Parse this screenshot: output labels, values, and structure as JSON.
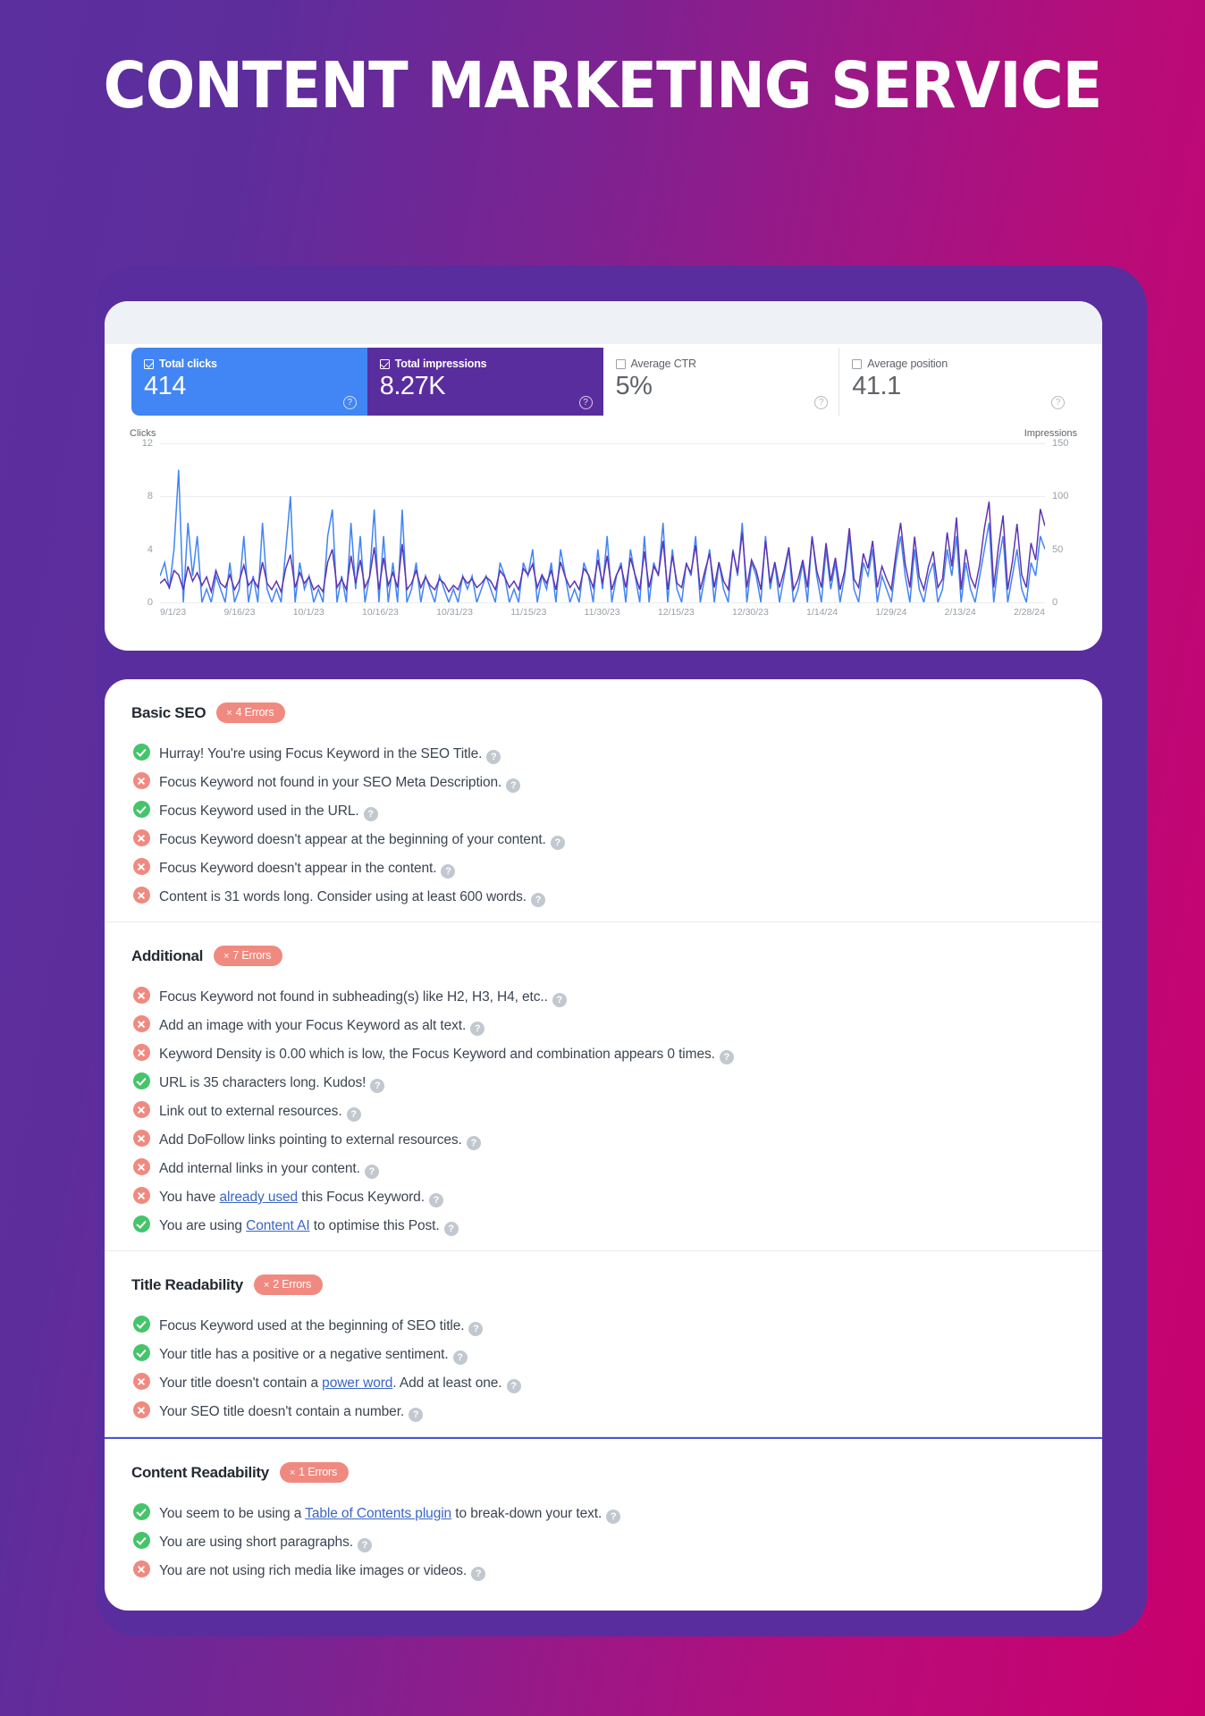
{
  "header": {
    "title": "CONTENT MARKETING SERVICE"
  },
  "metrics": [
    {
      "label": "Total clicks",
      "value": "414",
      "checked": true,
      "theme": "clicks"
    },
    {
      "label": "Total impressions",
      "value": "8.27K",
      "checked": true,
      "theme": "impressions"
    },
    {
      "label": "Average CTR",
      "value": "5%",
      "checked": false,
      "theme": "plain"
    },
    {
      "label": "Average position",
      "value": "41.1",
      "checked": false,
      "theme": "plain"
    }
  ],
  "chart_data": {
    "type": "line",
    "title": "",
    "left_axis_label": "Clicks",
    "right_axis_label": "Impressions",
    "left_ticks": [
      "12",
      "8",
      "4",
      "0"
    ],
    "right_ticks": [
      "150",
      "100",
      "50",
      "0"
    ],
    "ylim_left": [
      0,
      12
    ],
    "ylim_right": [
      0,
      150
    ],
    "grid": true,
    "legend_position": "none",
    "x_tick_labels": [
      "9/1/23",
      "9/16/23",
      "10/1/23",
      "10/16/23",
      "10/31/23",
      "11/15/23",
      "11/30/23",
      "12/15/23",
      "12/30/23",
      "1/14/24",
      "1/29/24",
      "2/13/24",
      "2/28/24"
    ],
    "series": [
      {
        "name": "Clicks",
        "color": "#4285f4",
        "axis": "left",
        "values": [
          2,
          3,
          1,
          4,
          10,
          0,
          6,
          2,
          5,
          0,
          1,
          0,
          2,
          1,
          0,
          3,
          0,
          1,
          5,
          0,
          2,
          0,
          6,
          1,
          0,
          1,
          0,
          4,
          8,
          0,
          3,
          1,
          2,
          0,
          1,
          0,
          5,
          7,
          0,
          2,
          0,
          6,
          1,
          5,
          0,
          2,
          7,
          0,
          5,
          0,
          3,
          0,
          7,
          0,
          1,
          3,
          0,
          2,
          1,
          0,
          2,
          1,
          0,
          1,
          0,
          2,
          1,
          2,
          0,
          1,
          2,
          1,
          0,
          3,
          2,
          0,
          1,
          0,
          3,
          2,
          4,
          0,
          2,
          1,
          3,
          0,
          4,
          2,
          0,
          1,
          0,
          3,
          2,
          0,
          4,
          1,
          5,
          0,
          2,
          3,
          0,
          4,
          2,
          0,
          5,
          0,
          3,
          2,
          6,
          0,
          4,
          1,
          0,
          3,
          2,
          5,
          0,
          2,
          4,
          0,
          3,
          1,
          0,
          4,
          2,
          6,
          0,
          3,
          2,
          0,
          5,
          1,
          3,
          0,
          2,
          4,
          0,
          1,
          3,
          0,
          5,
          2,
          0,
          4,
          1,
          3,
          0,
          2,
          5,
          1,
          0,
          3,
          2,
          4,
          0,
          2,
          1,
          0,
          3,
          5,
          2,
          0,
          4,
          1,
          0,
          2,
          3,
          0,
          1,
          4,
          2,
          5,
          0,
          3,
          1,
          0,
          2,
          4,
          6,
          0,
          3,
          5,
          0,
          2,
          4,
          1,
          0,
          3,
          2,
          5,
          4
        ]
      },
      {
        "name": "Impressions",
        "color": "#5e35b1",
        "axis": "right",
        "values": [
          18,
          22,
          14,
          30,
          26,
          12,
          34,
          20,
          28,
          16,
          24,
          10,
          30,
          18,
          14,
          26,
          12,
          20,
          35,
          16,
          22,
          14,
          38,
          18,
          12,
          20,
          10,
          32,
          45,
          14,
          28,
          18,
          24,
          12,
          16,
          10,
          38,
          50,
          14,
          22,
          12,
          44,
          18,
          40,
          14,
          24,
          52,
          12,
          42,
          16,
          28,
          14,
          55,
          12,
          18,
          30,
          14,
          24,
          16,
          12,
          22,
          18,
          10,
          16,
          12,
          24,
          18,
          22,
          14,
          18,
          24,
          20,
          12,
          30,
          24,
          14,
          20,
          12,
          32,
          26,
          36,
          14,
          26,
          18,
          30,
          12,
          38,
          24,
          14,
          20,
          12,
          32,
          26,
          14,
          40,
          18,
          44,
          12,
          26,
          34,
          14,
          42,
          26,
          12,
          48,
          14,
          34,
          26,
          58,
          12,
          44,
          18,
          14,
          36,
          28,
          54,
          12,
          30,
          46,
          14,
          38,
          20,
          12,
          48,
          28,
          66,
          14,
          40,
          30,
          12,
          58,
          18,
          38,
          14,
          30,
          52,
          12,
          22,
          40,
          14,
          62,
          30,
          14,
          56,
          20,
          42,
          12,
          30,
          70,
          22,
          14,
          46,
          32,
          58,
          14,
          34,
          22,
          12,
          46,
          75,
          36,
          14,
          62,
          24,
          12,
          34,
          48,
          14,
          22,
          66,
          34,
          80,
          12,
          50,
          24,
          14,
          36,
          70,
          95,
          14,
          52,
          82,
          12,
          38,
          74,
          26,
          14,
          56,
          40,
          88,
          72
        ]
      }
    ]
  },
  "seo_sections": [
    {
      "title": "Basic SEO",
      "badge": "4 Errors",
      "highlight": false,
      "items": [
        {
          "status": "ok",
          "text": "Hurray! You're using Focus Keyword in the SEO Title."
        },
        {
          "status": "err",
          "text": "Focus Keyword not found in your SEO Meta Description."
        },
        {
          "status": "ok",
          "text": "Focus Keyword used in the URL."
        },
        {
          "status": "err",
          "text": "Focus Keyword doesn't appear at the beginning of your content."
        },
        {
          "status": "err",
          "text": "Focus Keyword doesn't appear in the content."
        },
        {
          "status": "err",
          "text": "Content is 31 words long. Consider using at least 600 words."
        }
      ]
    },
    {
      "title": "Additional",
      "badge": "7 Errors",
      "highlight": false,
      "items": [
        {
          "status": "err",
          "text": "Focus Keyword not found in subheading(s) like H2, H3, H4, etc.."
        },
        {
          "status": "err",
          "text": "Add an image with your Focus Keyword as alt text."
        },
        {
          "status": "err",
          "text": "Keyword Density is 0.00 which is low, the Focus Keyword and combination appears 0 times."
        },
        {
          "status": "ok",
          "text": "URL is 35 characters long. Kudos!"
        },
        {
          "status": "err",
          "text": "Link out to external resources."
        },
        {
          "status": "err",
          "text": "Add DoFollow links pointing to external resources."
        },
        {
          "status": "err",
          "text": "Add internal links in your content."
        },
        {
          "status": "err",
          "text": "You have already used this Focus Keyword.",
          "link": "already used"
        },
        {
          "status": "ok",
          "text": "You are using Content AI to optimise this Post.",
          "link": "Content AI"
        }
      ]
    },
    {
      "title": "Title Readability",
      "badge": "2 Errors",
      "highlight": false,
      "items": [
        {
          "status": "ok",
          "text": "Focus Keyword used at the beginning of SEO title."
        },
        {
          "status": "ok",
          "text": "Your title has a positive or a negative sentiment."
        },
        {
          "status": "err",
          "text": "Your title doesn't contain a power word. Add at least one.",
          "link": "power word"
        },
        {
          "status": "err",
          "text": "Your SEO title doesn't contain a number."
        }
      ]
    },
    {
      "title": "Content Readability",
      "badge": "1 Errors",
      "highlight": true,
      "items": [
        {
          "status": "ok",
          "text": "You seem to be using a Table of Contents plugin to break-down your text.",
          "link": "Table of Contents plugin"
        },
        {
          "status": "ok",
          "text": "You are using short paragraphs."
        },
        {
          "status": "err",
          "text": "You are not using rich media like images or videos."
        }
      ]
    }
  ],
  "icons": {
    "help": "?",
    "error_x": "×"
  },
  "colors": {
    "accent_purple": "#5a2d9e",
    "accent_magenta": "#c9006d",
    "clicks_blue": "#4285f4",
    "impressions_purple": "#5e35b1",
    "error_badge": "#f08a80",
    "success_green": "#46c46b"
  }
}
